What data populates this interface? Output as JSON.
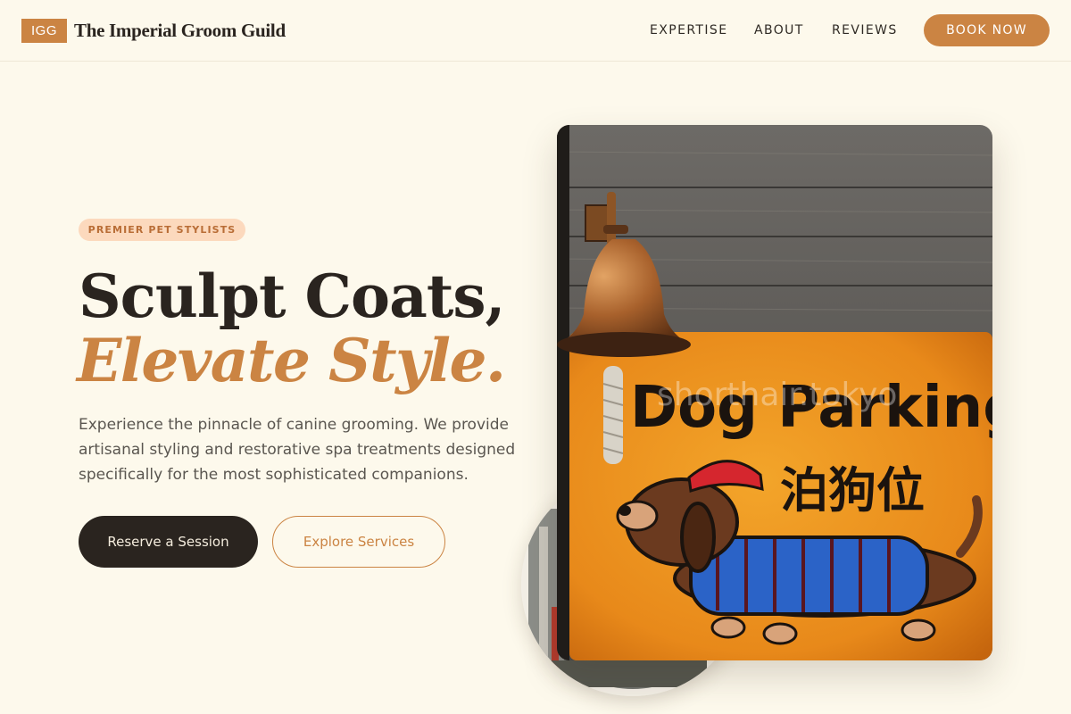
{
  "header": {
    "logo_text": "IGG",
    "brand_name": "The Imperial Groom Guild",
    "nav": [
      {
        "label": "EXPERTISE"
      },
      {
        "label": "ABOUT"
      },
      {
        "label": "REVIEWS"
      }
    ],
    "cta_label": "BOOK NOW"
  },
  "hero": {
    "badge": "PREMIER PET STYLISTS",
    "headline_line1": "Sculpt Coats,",
    "headline_line2": "Elevate Style.",
    "description": "Experience the pinnacle of canine grooming. We provide artisanal styling and restorative spa treatments designed specifically for the most sophisticated companions.",
    "primary_button": "Reserve a Session",
    "secondary_button": "Explore Services"
  },
  "photo": {
    "sign_text_en": "Dog Parking",
    "sign_text_jp": "泊狗位",
    "watermark": "shorthair.tokyo"
  },
  "colors": {
    "background": "#fdf9ec",
    "accent": "#cb8443",
    "dark": "#2a241f",
    "badge_bg": "#fcd9bd"
  }
}
